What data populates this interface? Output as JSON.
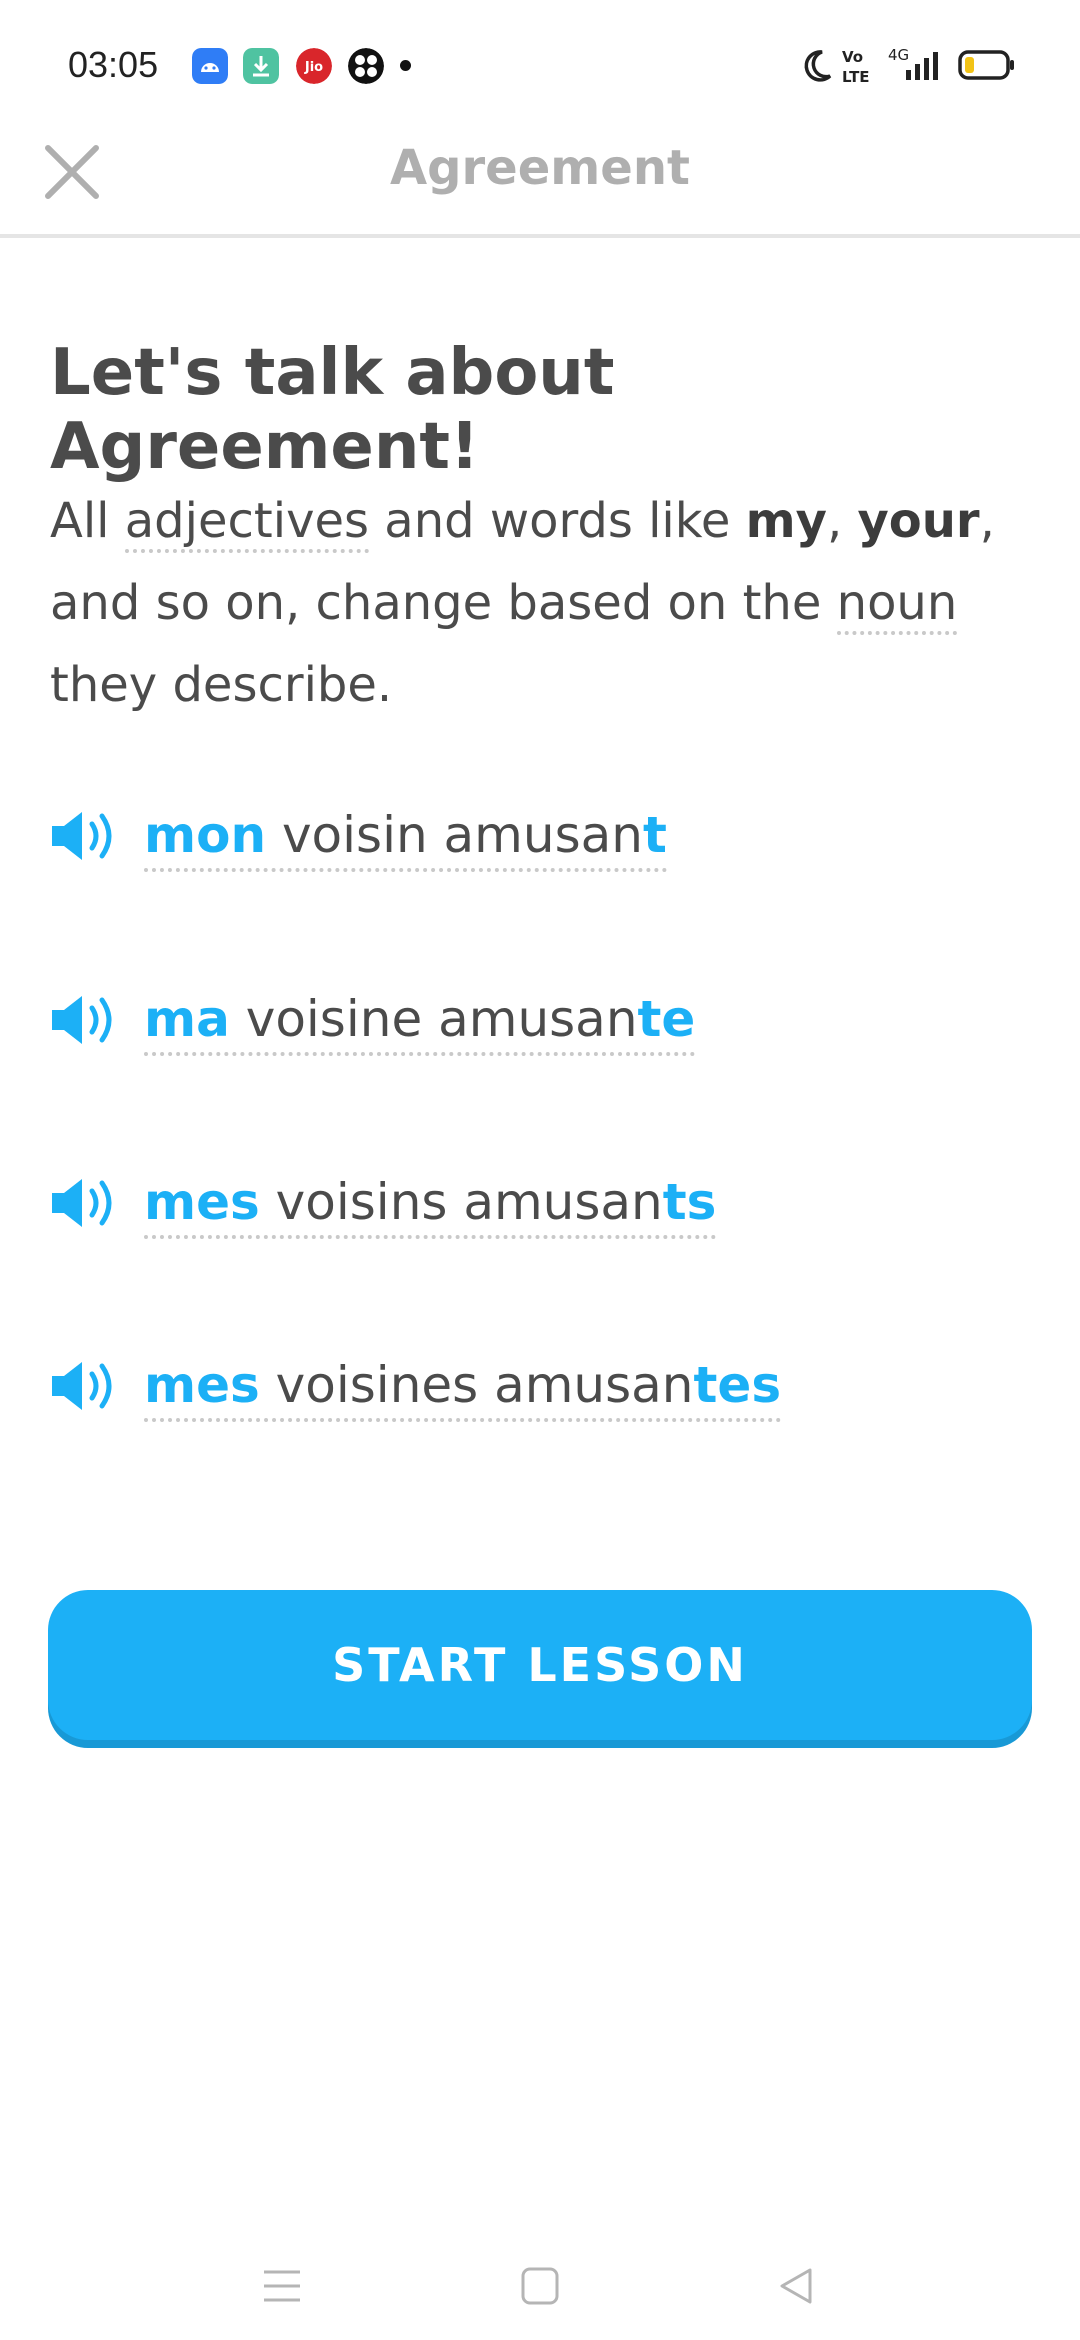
{
  "status_bar": {
    "time": "03:05",
    "icons": [
      "android-app-icon",
      "download-icon",
      "jio-icon",
      "flower-app-icon"
    ],
    "jio_label": "Jio",
    "network_label": "4G",
    "volte_label": "Vo LTE"
  },
  "header": {
    "title": "Agreement",
    "close_icon": "close-icon"
  },
  "content": {
    "headline": "Let's talk about Agreement!",
    "intro": {
      "part1": "All ",
      "hint1": "adjectives",
      "part2": " and words like ",
      "bold1": "my",
      "part3": ", ",
      "bold2": "your",
      "part4": ", and so on, change based on the ",
      "hint2": "noun",
      "part5": " they describe."
    },
    "phrases": [
      {
        "lead": "mon",
        "middle": " voisin amusan",
        "ending": "t"
      },
      {
        "lead": "ma",
        "middle": " voisine amusan",
        "ending": "te"
      },
      {
        "lead": "mes",
        "middle": " voisins amusan",
        "ending": "ts"
      },
      {
        "lead": "mes",
        "middle": " voisines amusan",
        "ending": "tes"
      }
    ]
  },
  "start_button": {
    "label": "START LESSON"
  },
  "colors": {
    "accent": "#1cb0f6",
    "accent_shadow": "#1899d6",
    "text": "#4b4b4b",
    "muted": "#afafaf"
  },
  "nav_bar": {
    "icons": [
      "menu-icon",
      "home-icon",
      "back-icon"
    ]
  }
}
